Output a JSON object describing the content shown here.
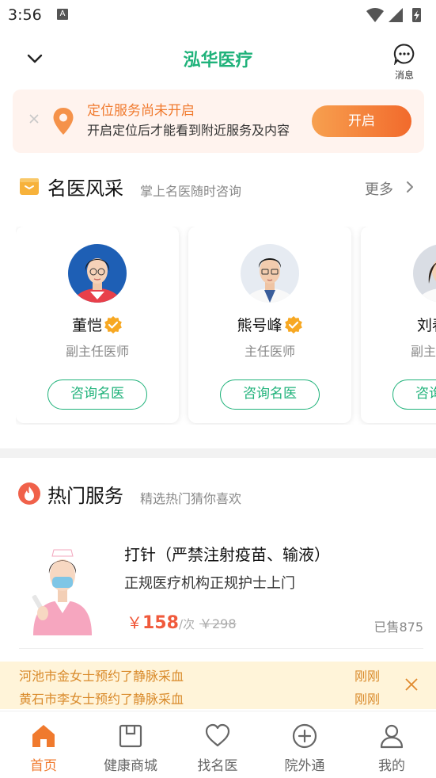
{
  "status": {
    "time": "3:56",
    "a_icon": "A"
  },
  "header": {
    "title": "泓华医疗",
    "message_label": "消息"
  },
  "location_banner": {
    "title": "定位服务尚未开启",
    "description": "开启定位后才能看到附近服务及内容",
    "button": "开启"
  },
  "doctors_section": {
    "title": "名医风采",
    "subtitle": "掌上名医随时咨询",
    "more": "更多"
  },
  "doctors": [
    {
      "name": "董恺",
      "title": "副主任医师",
      "button": "咨询名医"
    },
    {
      "name": "熊号峰",
      "title": "主任医师",
      "button": "咨询名医"
    },
    {
      "name": "刘春",
      "title": "副主任医师",
      "button": "咨询名医"
    }
  ],
  "services_section": {
    "title": "热门服务",
    "subtitle": "精选热门猜你喜欢"
  },
  "service": {
    "title": "打针（严禁注射疫苗、输液）",
    "description": "正规医疗机构正规护士上门",
    "currency": "￥",
    "price": "158",
    "unit": "/次",
    "old_price": "￥298",
    "sold": "已售875"
  },
  "notices": [
    {
      "text": "河池市金女士预约了静脉采血",
      "time": "刚刚"
    },
    {
      "text": "黄石市李女士预约了静脉采血",
      "time": "刚刚"
    }
  ],
  "tabs": [
    {
      "label": "首页",
      "icon": "home-icon",
      "active": true
    },
    {
      "label": "健康商城",
      "icon": "shop-icon",
      "active": false
    },
    {
      "label": "找名医",
      "icon": "heart-icon",
      "active": false
    },
    {
      "label": "院外通",
      "icon": "plus-circle-icon",
      "active": false
    },
    {
      "label": "我的",
      "icon": "user-icon",
      "active": false
    }
  ],
  "colors": {
    "brand_green": "#1fb27a",
    "accent_orange": "#f07a2e",
    "price_red": "#f05a3c"
  }
}
